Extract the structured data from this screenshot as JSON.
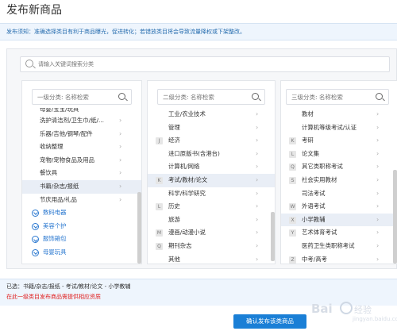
{
  "page": {
    "title": "发布新商品",
    "notice": "发布须知：准确选择类目有利于商品曝光，促进转化；若错放类目将会导致流量降权或下架整改。"
  },
  "search": {
    "placeholder": "请输入关键词搜索分类"
  },
  "col1": {
    "placeholder": "一级分类: 名称检索",
    "items": [
      {
        "label": "母婴/宝宝/玩具",
        "partial": true
      },
      {
        "label": "洗护清洁剂/卫生巾/纸/..."
      },
      {
        "label": "乐器/吉他/钢琴/配件"
      },
      {
        "label": "收纳整理"
      },
      {
        "label": "宠物/宠物食品及用品"
      },
      {
        "label": "餐饮具"
      },
      {
        "label": "书籍/杂志/报纸",
        "selected": true
      },
      {
        "label": "节庆用品/礼品"
      }
    ],
    "groups": [
      "数码电器",
      "美容个护",
      "服饰箱包",
      "母婴玩具"
    ]
  },
  "col2": {
    "placeholder": "二级分类: 名称检索",
    "items": [
      {
        "letter": "",
        "label": "工业/农业技术"
      },
      {
        "letter": "",
        "label": "管理"
      },
      {
        "letter": "J",
        "label": "经济"
      },
      {
        "letter": "",
        "label": "进口原版书(含港台)"
      },
      {
        "letter": "",
        "label": "计算机/网络"
      },
      {
        "letter": "K",
        "label": "考试/教材/论文",
        "selected": true
      },
      {
        "letter": "",
        "label": "科学/科学研究"
      },
      {
        "letter": "L",
        "label": "历史"
      },
      {
        "letter": "",
        "label": "旅游"
      },
      {
        "letter": "M",
        "label": "漫画/动漫小说"
      },
      {
        "letter": "Q",
        "label": "期刊杂志"
      },
      {
        "letter": "",
        "label": "其他"
      }
    ]
  },
  "col3": {
    "placeholder": "三级分类: 名称检索",
    "items": [
      {
        "letter": "",
        "label": "教材"
      },
      {
        "letter": "",
        "label": "计算机等级考试/认证"
      },
      {
        "letter": "K",
        "label": "考研"
      },
      {
        "letter": "L",
        "label": "论文集"
      },
      {
        "letter": "Q",
        "label": "其它类职称考试"
      },
      {
        "letter": "S",
        "label": "社会实用教材"
      },
      {
        "letter": "",
        "label": "司法考试"
      },
      {
        "letter": "W",
        "label": "外语考试"
      },
      {
        "letter": "X",
        "label": "小学教辅",
        "selected": true
      },
      {
        "letter": "Y",
        "label": "艺术体育考试"
      },
      {
        "letter": "",
        "label": "医药卫生类职称考试"
      },
      {
        "letter": "Z",
        "label": "中考/高考"
      }
    ]
  },
  "status": {
    "chosen": "已选：书籍/杂志/报纸 - 考试/教材/论文 - 小学教辅",
    "warning": "在此一级类目发布商品需提供相应资质"
  },
  "confirm_label": "确认发布该类商品",
  "watermark": {
    "brand": "Bai",
    "brand2": "经验",
    "url": "jingyan.baidu.com"
  }
}
